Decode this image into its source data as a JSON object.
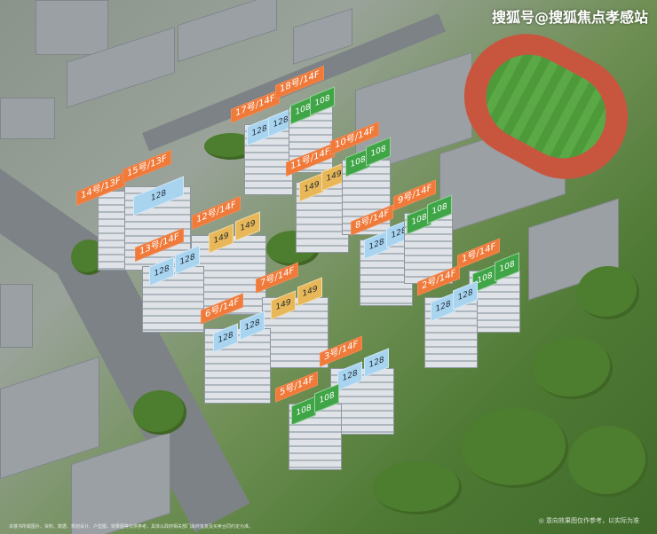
{
  "watermark": "搜狐号@搜狐焦点孝感站",
  "disclaimer_note": "◎ 意向效果图仅作参考，以实际为准",
  "disclaimer": "本楼书所载图片、资料、数据、规划设计、户型图、效果图等仅供参考，具体以政府相关部门最终批复及买卖合同约定为准。",
  "colors": {
    "tag": "#f07a3a",
    "unit_128": "#a9d4f0",
    "unit_149": "#e8b758",
    "unit_108": "#3fa546"
  },
  "buildings": [
    {
      "id": "b14",
      "tag": "14号/13F",
      "units": []
    },
    {
      "id": "b15",
      "tag": "15号/13F",
      "units": [
        "128"
      ]
    },
    {
      "id": "b17",
      "tag": "17号/14F",
      "units": [
        "128",
        "128"
      ]
    },
    {
      "id": "b18",
      "tag": "18号/14F",
      "units": [
        "108",
        "108"
      ]
    },
    {
      "id": "b11",
      "tag": "11号/14F",
      "units": [
        "149",
        "149"
      ]
    },
    {
      "id": "b10",
      "tag": "10号/14F",
      "units": [
        "108",
        "108"
      ]
    },
    {
      "id": "b12",
      "tag": "12号/14F",
      "units": [
        "149",
        "149"
      ]
    },
    {
      "id": "b13",
      "tag": "13号/14F",
      "units": [
        "128",
        "128"
      ]
    },
    {
      "id": "b8",
      "tag": "8号/14F",
      "units": [
        "128",
        "128"
      ]
    },
    {
      "id": "b9",
      "tag": "9号/14F",
      "units": [
        "108",
        "108"
      ]
    },
    {
      "id": "b7",
      "tag": "7号/14F",
      "units": [
        "149",
        "149"
      ]
    },
    {
      "id": "b6",
      "tag": "6号/14F",
      "units": [
        "128",
        "128"
      ]
    },
    {
      "id": "b1",
      "tag": "1号/14F",
      "units": [
        "108",
        "108"
      ]
    },
    {
      "id": "b2",
      "tag": "2号/14F",
      "units": [
        "128",
        "128"
      ]
    },
    {
      "id": "b3",
      "tag": "3号/14F",
      "units": [
        "128",
        "128"
      ]
    },
    {
      "id": "b5",
      "tag": "5号/14F",
      "units": [
        "108",
        "108"
      ]
    }
  ]
}
